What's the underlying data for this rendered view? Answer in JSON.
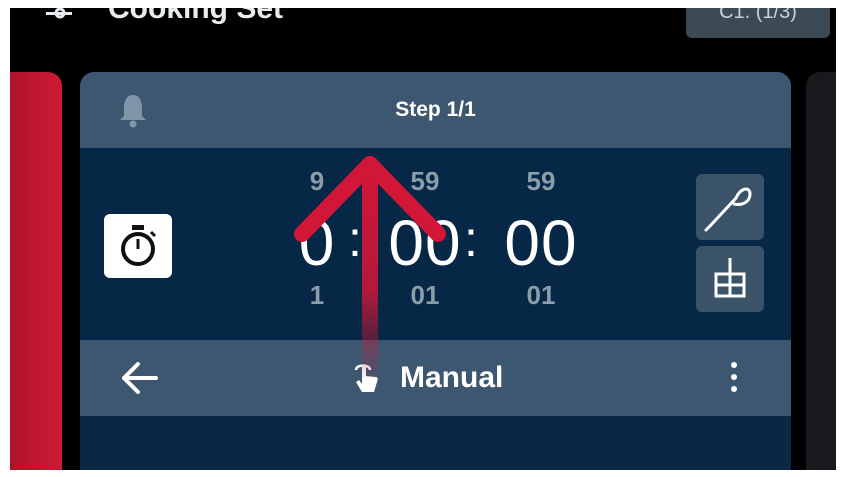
{
  "header": {
    "title": "Cooking Set",
    "right_button": "C1. (1/3)"
  },
  "step": {
    "label": "Step 1/1"
  },
  "timer": {
    "hours": {
      "prev": "9",
      "current": "0",
      "next": "1"
    },
    "minutes": {
      "prev": "59",
      "current": "00",
      "next": "01"
    },
    "seconds": {
      "prev": "59",
      "current": "00",
      "next": "01"
    },
    "separator": ":"
  },
  "mode": {
    "label": "Manual"
  },
  "colors": {
    "accent_red": "#d21638",
    "card_header": "#3c576f",
    "timer_bg": "#062745"
  },
  "icons": [
    "settings-sliders-icon",
    "bell-icon",
    "stopwatch-icon",
    "probe-icon",
    "steam-icon",
    "back-arrow-icon",
    "hand-touch-icon",
    "kebab-menu-icon",
    "swipe-up-arrow-icon"
  ]
}
